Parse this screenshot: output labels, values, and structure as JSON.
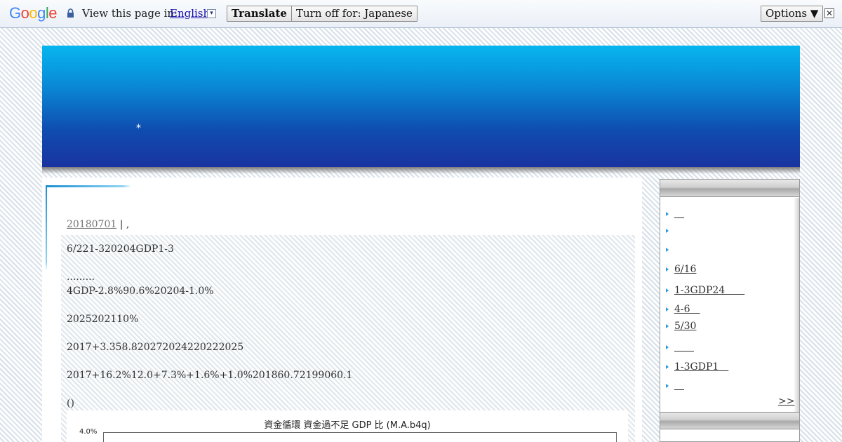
{
  "translate_bar": {
    "logo": "Google",
    "view_text": "View this page in:",
    "language": "English",
    "dropdown_glyph": "▾",
    "translate_label": "Translate",
    "turn_off_label": "Turn off for: Japanese",
    "options_label": "Options ▼",
    "close_glyph": "✕"
  },
  "header": {
    "star": "*"
  },
  "post": {
    "date": "20180701",
    "date_sep": "| ,",
    "lines": [
      "6/221-320204GDP1-3",
      ".........",
      "4GDP-2.8%90.6%20204-1.0%",
      "2025202110%",
      "2017+3.358.820272024220222025",
      "2017+16.2%12.0+7.3%+1.6%+1.0%201860.72199060.1",
      "()"
    ]
  },
  "chart": {
    "title": "資金循環 資金過不足 GDP 比 (M.A.b4q)",
    "y_tick_top": "4.0%"
  },
  "sidebar": {
    "items": [
      {
        "label": "＿"
      },
      {
        "label": ""
      },
      {
        "label": ""
      },
      {
        "label": "6/16"
      },
      {
        "label": "1-3GDP24　　"
      },
      {
        "label": "4-6　"
      },
      {
        "label": "5/30"
      },
      {
        "label": "　　"
      },
      {
        "label": "1-3GDP1　"
      },
      {
        "label": "＿"
      }
    ],
    "more_label": ">>"
  },
  "colors": {
    "banner_top": "#07b6ef",
    "banner_bottom": "#1a33a0",
    "link_blue": "#1a0dab",
    "bullet_blue": "#2a9bd8"
  }
}
